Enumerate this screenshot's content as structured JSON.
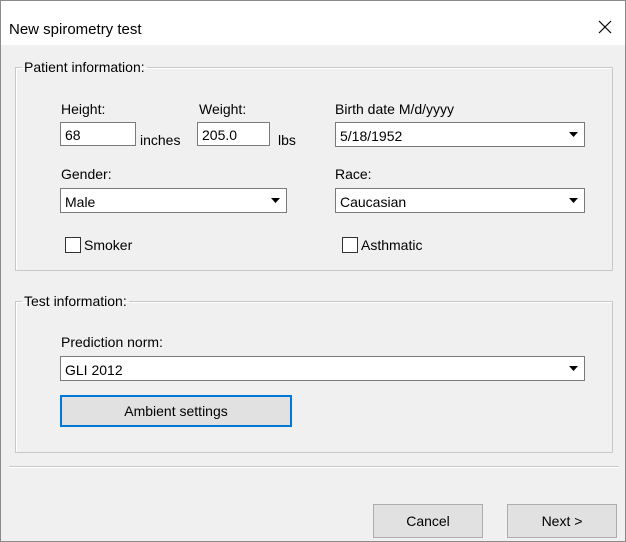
{
  "window": {
    "title": "New spirometry test"
  },
  "patient": {
    "group_label": "Patient information:",
    "height_label": "Height:",
    "height_value": "68",
    "height_unit": "inches",
    "weight_label": "Weight:",
    "weight_value": "205.0",
    "weight_unit": "lbs",
    "birth_label": "Birth date M/d/yyyy",
    "birth_value": "5/18/1952",
    "gender_label": "Gender:",
    "gender_value": "Male",
    "race_label": "Race:",
    "race_value": "Caucasian",
    "smoker_label": "Smoker",
    "smoker_checked": false,
    "asthmatic_label": "Asthmatic",
    "asthmatic_checked": false
  },
  "test": {
    "group_label": "Test information:",
    "norm_label": "Prediction norm:",
    "norm_value": "GLI 2012",
    "ambient_button": "Ambient settings"
  },
  "footer": {
    "cancel_label": "Cancel",
    "next_label": "Next >"
  },
  "icons": {
    "close": "close-icon",
    "dropdown": "chevron-down-icon"
  },
  "colors": {
    "focus_border": "#0078d7",
    "dialog_bg": "#f0f0f0"
  }
}
